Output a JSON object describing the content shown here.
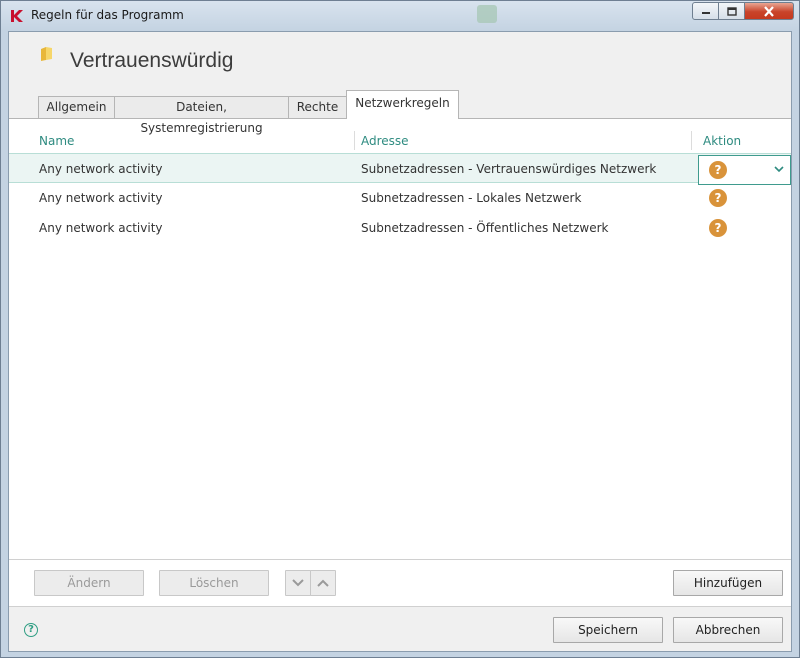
{
  "window": {
    "title": "Regeln für das Programm"
  },
  "header": {
    "title": "Vertrauenswürdig"
  },
  "tabs": [
    {
      "label": "Allgemein"
    },
    {
      "label": "Dateien, Systemregistrierung"
    },
    {
      "label": "Rechte"
    },
    {
      "label": "Netzwerkregeln"
    }
  ],
  "active_tab": "Netzwerkregeln",
  "table": {
    "columns": [
      "Name",
      "Adresse",
      "Aktion"
    ],
    "rows": [
      {
        "name": "Any network activity",
        "address": "Subnetzadressen - Vertrauenswürdiges Netzwerk",
        "action": "?",
        "selected": true
      },
      {
        "name": "Any network activity",
        "address": "Subnetzadressen - Lokales Netzwerk",
        "action": "?"
      },
      {
        "name": "Any network activity",
        "address": "Subnetzadressen - Öffentliches Netzwerk",
        "action": "?"
      }
    ]
  },
  "toolbar": {
    "edit_label": "Ändern",
    "delete_label": "Löschen",
    "add_label": "Hinzufügen"
  },
  "footer": {
    "save_label": "Speichern",
    "cancel_label": "Abbrechen",
    "help_glyph": "?"
  },
  "icons": {
    "app": "kaspersky-logo-icon",
    "folder": "folder-icon",
    "action": "question-icon",
    "help": "help-icon"
  },
  "colors": {
    "accent": "#2e8b80",
    "question": "#d9933a",
    "selection": "#ebf5f3",
    "close_button": "#c9442a"
  }
}
